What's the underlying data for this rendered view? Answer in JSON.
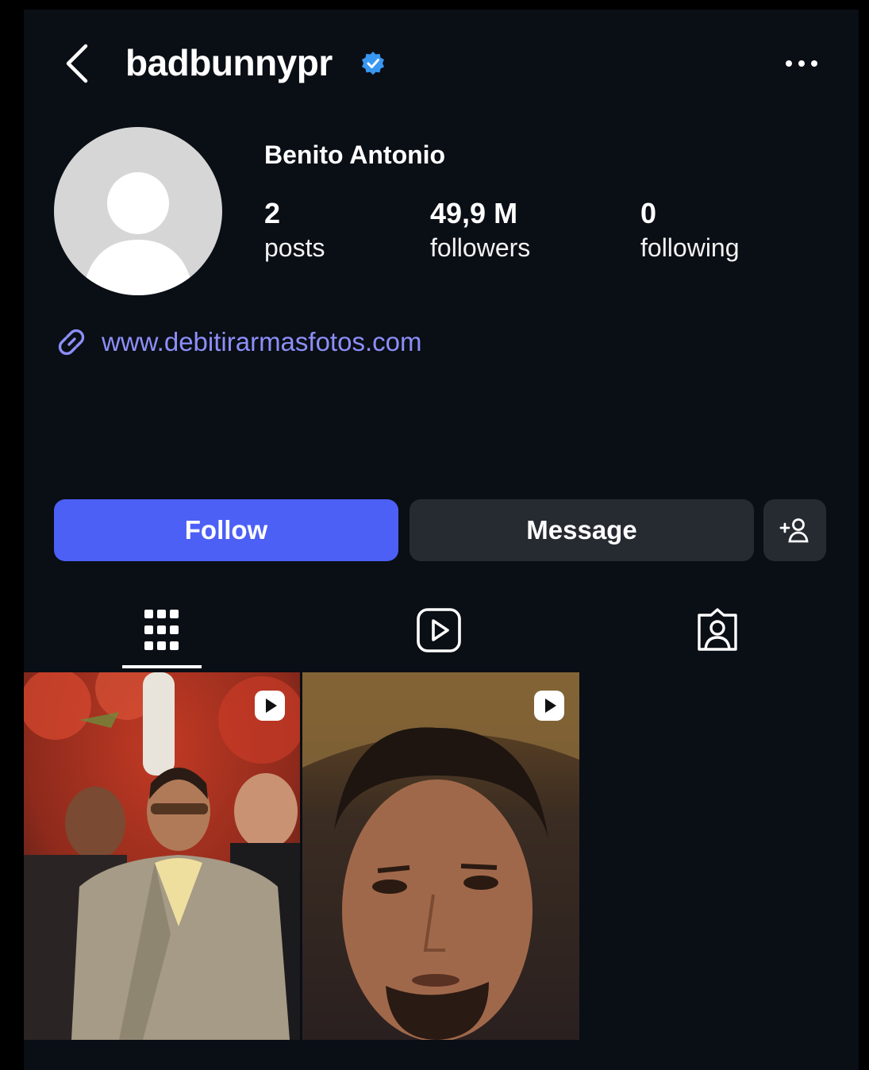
{
  "header": {
    "username": "badbunnypr",
    "verified_icon": "verified-badge-icon",
    "verified_color": "#3897f0"
  },
  "profile": {
    "display_name": "Benito Antonio",
    "stats": [
      {
        "value": "2",
        "label": "posts"
      },
      {
        "value": "49,9 M",
        "label": "followers"
      },
      {
        "value": "0",
        "label": "following"
      }
    ],
    "link": "www.debitirarmasfotos.com",
    "link_color": "#8c8ff7"
  },
  "actions": {
    "follow_label": "Follow",
    "message_label": "Message",
    "follow_color": "#4c60f5"
  },
  "tabs": [
    {
      "name": "posts",
      "icon": "grid-icon",
      "selected": true
    },
    {
      "name": "reels",
      "icon": "reels-icon",
      "selected": false
    },
    {
      "name": "tagged",
      "icon": "tagged-icon",
      "selected": false
    }
  ],
  "posts": [
    {
      "type": "reel",
      "icon": "reel-play-icon"
    },
    {
      "type": "reel",
      "icon": "reel-play-icon"
    }
  ]
}
